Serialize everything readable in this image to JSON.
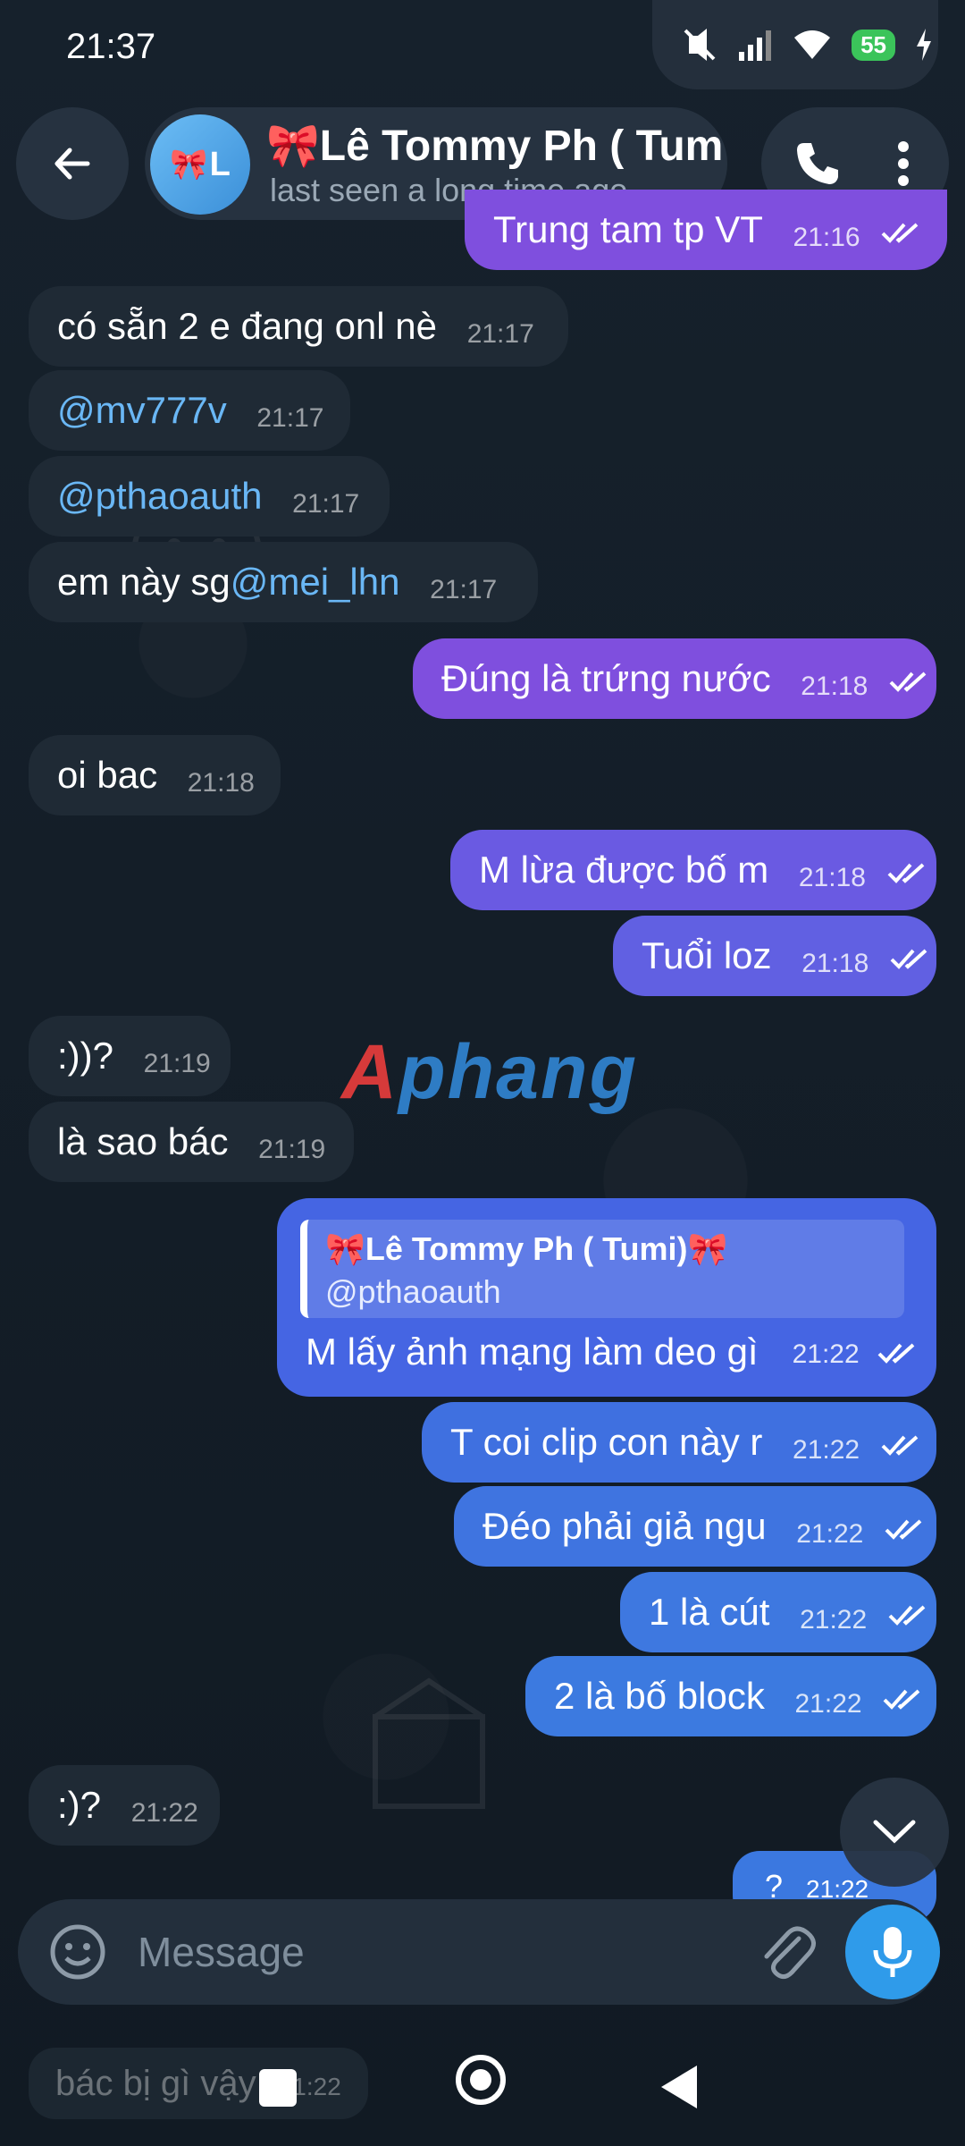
{
  "status_bar": {
    "time": "21:37",
    "battery": "55"
  },
  "header": {
    "contact_name": "🎀Lê Tommy Ph ( Tumi)🎀",
    "last_seen": "last seen a long time ago",
    "avatar_initial": "L"
  },
  "messages": [
    {
      "dir": "out",
      "text": "Trung tam tp VT",
      "time": "21:16"
    },
    {
      "dir": "in",
      "text": "có sẵn 2 e đang onl nè",
      "time": "21:17"
    },
    {
      "dir": "in",
      "text": "@mv777v",
      "time": "21:17"
    },
    {
      "dir": "in",
      "text": "@pthaoauth",
      "time": "21:17"
    },
    {
      "dir": "in",
      "text_prefix": "em này sg ",
      "mention": "@mei_lhn",
      "time": "21:17"
    },
    {
      "dir": "out",
      "text": "Đúng là trứng nước",
      "time": "21:18"
    },
    {
      "dir": "in",
      "text": "oi bac",
      "time": "21:18"
    },
    {
      "dir": "out",
      "text": "M lừa được bố m",
      "time": "21:18"
    },
    {
      "dir": "out",
      "text": "Tuổi loz",
      "time": "21:18"
    },
    {
      "dir": "in",
      "text": ":))?",
      "time": "21:19"
    },
    {
      "dir": "in",
      "text": "là sao bác",
      "time": "21:19"
    },
    {
      "dir": "out",
      "text": "T coi clip con này r",
      "time": "21:22"
    },
    {
      "dir": "out",
      "text": "Đéo phải giả ngu",
      "time": "21:22"
    },
    {
      "dir": "out",
      "text": "1 là cút",
      "time": "21:22"
    },
    {
      "dir": "out",
      "text": "2 là bố block",
      "time": "21:22"
    },
    {
      "dir": "in",
      "text": ":)?",
      "time": "21:22"
    }
  ],
  "reply_message": {
    "quote_author": "🎀Lê Tommy Ph ( Tumi)🎀",
    "quote_text": "@pthaoauth",
    "text": "M lấy ảnh mạng làm deo gì",
    "time": "21:22"
  },
  "partial_out_message": {
    "text": "?",
    "time": "21:22"
  },
  "behind_message": {
    "text": "bác bị gì vậy",
    "time": "21:22"
  },
  "watermark": {
    "first": "A",
    "rest": "phang"
  },
  "input": {
    "placeholder": "Message"
  },
  "colors": {
    "out_purple": "#7f4fde",
    "out_blue": "#3f74e0",
    "in_bubble": "#1f2a35",
    "mention": "#6ab7f5",
    "mic": "#2f9bea"
  }
}
